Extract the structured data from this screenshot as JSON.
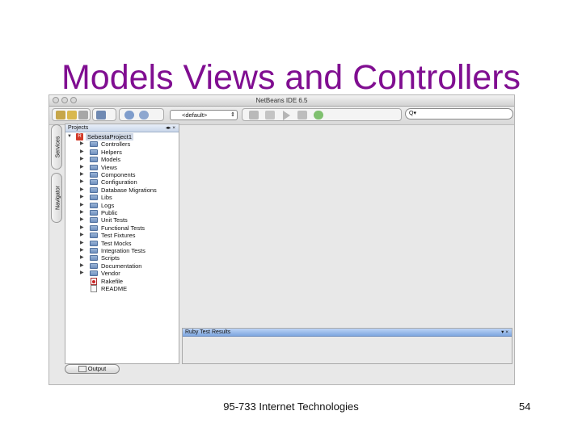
{
  "slide": {
    "title": "Models Views and Controllers",
    "footer": "95-733 Internet Technologies",
    "page_number": "54"
  },
  "window": {
    "title": "NetBeans IDE 6.5",
    "config_value": "<default>",
    "search_value": "Q▾"
  },
  "side_tabs": {
    "services": "Services",
    "navigator": "Navigator"
  },
  "projects_panel": {
    "title": "Projects",
    "controls": "◂▸ ×",
    "project_name": "SebestaProject1",
    "items": [
      {
        "label": "Controllers",
        "kind": "folder"
      },
      {
        "label": "Helpers",
        "kind": "folder"
      },
      {
        "label": "Models",
        "kind": "folder"
      },
      {
        "label": "Views",
        "kind": "folder"
      },
      {
        "label": "Components",
        "kind": "folder"
      },
      {
        "label": "Configuration",
        "kind": "folder"
      },
      {
        "label": "Database Migrations",
        "kind": "folder"
      },
      {
        "label": "Libs",
        "kind": "folder"
      },
      {
        "label": "Logs",
        "kind": "folder"
      },
      {
        "label": "Public",
        "kind": "folder"
      },
      {
        "label": "Unit Tests",
        "kind": "folder"
      },
      {
        "label": "Functional Tests",
        "kind": "folder"
      },
      {
        "label": "Test Fixtures",
        "kind": "folder"
      },
      {
        "label": "Test Mocks",
        "kind": "folder"
      },
      {
        "label": "Integration Tests",
        "kind": "folder"
      },
      {
        "label": "Scripts",
        "kind": "folder"
      },
      {
        "label": "Documentation",
        "kind": "folder"
      },
      {
        "label": "Vendor",
        "kind": "folder"
      },
      {
        "label": "Rakefile",
        "kind": "ruby-file"
      },
      {
        "label": "README",
        "kind": "file"
      }
    ]
  },
  "results_panel": {
    "title": "Ruby Test Results",
    "controls": "▾ ×"
  },
  "output_tab": {
    "label": "Output"
  },
  "colors": {
    "title": "#800e91",
    "folder": "#6f8fbf",
    "results_header": "#7ea6df"
  }
}
